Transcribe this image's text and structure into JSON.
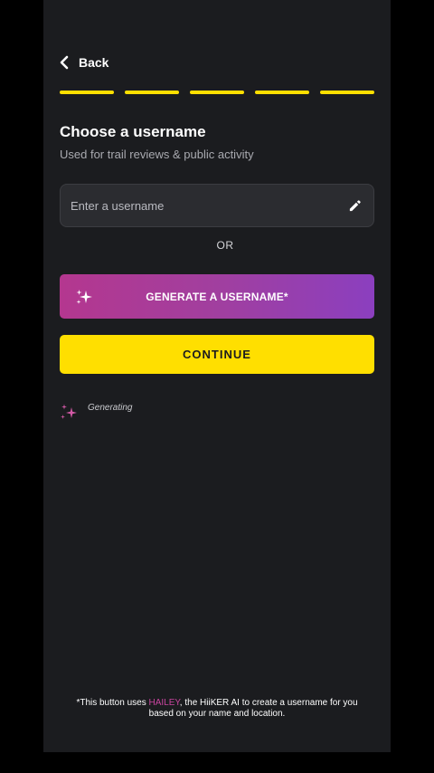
{
  "header": {
    "back_label": "Back",
    "back_icon": "chevron-left-icon",
    "progress_steps": 5,
    "progress_color": "#ffdf00"
  },
  "main": {
    "title": "Choose a username",
    "subtitle": "Used for trail reviews & public activity",
    "username_input": {
      "value": "",
      "placeholder": "Enter a username",
      "icon": "pencil-icon"
    },
    "or_label": "OR",
    "generate_button": {
      "label": "GENERATE A USERNAME*",
      "icon": "sparkle-icon",
      "gradient_start": "#b4378f",
      "gradient_end": "#8b3fbf"
    },
    "continue_button": {
      "label": "CONTINUE",
      "color": "#ffdf00"
    },
    "status": {
      "label": "Generating",
      "icon": "sparkle-icon"
    }
  },
  "footnote": {
    "prefix": "*This button uses ",
    "highlight_parts": [
      "H",
      "AI",
      "LEY"
    ],
    "suffix": ", the HiiKER AI to create a username for you based on your name and location.",
    "highlight_color": "#c9449f"
  }
}
